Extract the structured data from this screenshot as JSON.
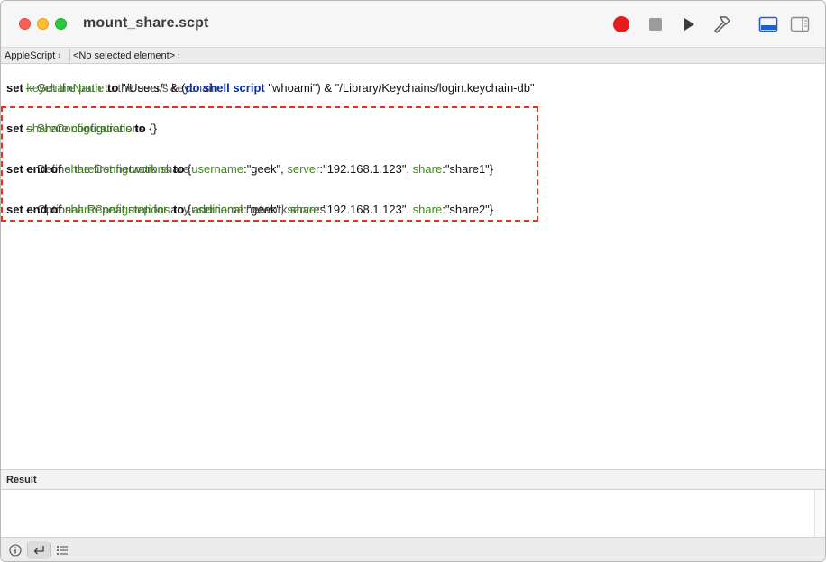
{
  "window": {
    "title": "mount_share.scpt"
  },
  "toolbar": {
    "record_icon": "record-icon",
    "stop_icon": "stop-icon",
    "run_icon": "run-icon",
    "compile_icon": "hammer-icon",
    "show_log_icon": "bottom-panel-icon",
    "show_inspector_icon": "sidebar-icon"
  },
  "navbar": {
    "language": "AppleScript",
    "element": "<No selected element>"
  },
  "code": {
    "l1": {
      "comment": "-- Get the path to the user's keychain"
    },
    "l2": {
      "set": "set",
      "var": "keychainName",
      "to": "to",
      "s1": "\"/Users/\"",
      "amp1": " & (",
      "do": "do shell script",
      "s2": "\"whoami\"",
      "amp2": ") & ",
      "s3": "\"/Library/Keychains/login.keychain-db\""
    },
    "l4": {
      "comment": "-- Share configurations"
    },
    "l5": {
      "set": "set",
      "var": "shareConfigurations",
      "to": "to",
      "rest": "{}"
    },
    "l7": {
      "comment": "-- Define the first network share"
    },
    "l8": {
      "set": "set end of",
      "var": "shareConfigurations",
      "to": "to",
      "open": "{",
      "k1": "username",
      "v1": ":\"geek\", ",
      "k2": "server",
      "v2": ":\"192.168.1.123\", ",
      "k3": "share",
      "v3": ":\"share1\"}"
    },
    "l10": {
      "comment": "-- Optional: Repeat step for any additional network shares"
    },
    "l11": {
      "set": "set end of",
      "var": "shareConfigurations",
      "to": "to",
      "open": "{",
      "k1": "username",
      "v1": ":\"geek\", ",
      "k2": "server",
      "v2": ":\"192.168.1.123\", ",
      "k3": "share",
      "v3": ":\"share2\"}"
    }
  },
  "result": {
    "label": "Result",
    "value": ""
  },
  "bottom": {
    "info_icon": "info-icon",
    "return_icon": "return-arrow-icon",
    "list_icon": "list-icon"
  },
  "colors": {
    "highlight_border": "#e8321c",
    "record": "#e41c1c",
    "keyword_blue": "#0c2ea6",
    "variable_green": "#3e8a1c",
    "accent": "#1f5fd1"
  }
}
